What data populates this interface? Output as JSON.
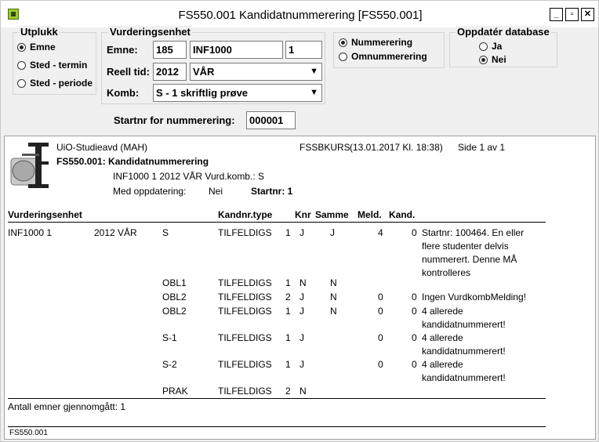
{
  "window": {
    "title": "FS550.001 Kandidatnummerering [FS550.001]"
  },
  "utplukk": {
    "title": "Utplukk",
    "options": [
      "Emne",
      "Sted - termin",
      "Sted - periode"
    ],
    "selected": 0
  },
  "vurderingsenhet": {
    "title": "Vurderingsenhet",
    "emne_label": "Emne:",
    "emne_institusjon": "185",
    "emne_kode": "INF1000",
    "emne_versjon": "1",
    "reell_tid_label": "Reell tid:",
    "aar": "2012",
    "termin": "VÅR",
    "komb_label": "Komb:",
    "komb": "S -  1 skriftlig prøve"
  },
  "mode": {
    "options": [
      "Nummerering",
      "Omnummerering"
    ],
    "selected": 0
  },
  "oppdater": {
    "title": "Oppdatér database",
    "options": [
      "Ja",
      "Nei"
    ],
    "selected": 1
  },
  "startnr": {
    "label": "Startnr for nummerering:",
    "value": "000001"
  },
  "report": {
    "org": "UiO-Studieavd (MAH)",
    "report_id": "FSSBKURS",
    "timestamp": "(13.01.2017 Kl. 18:38)",
    "page": "Side 1 av 1",
    "title": "FS550.001: Kandidatnummerering",
    "subtitle": "INF1000 1 2012 VÅR Vurd.komb.: S",
    "med_opp_label": "Med oppdatering:",
    "med_opp_value": "Nei",
    "startnr_label": "Startnr: 1",
    "headers": [
      "Vurderingsenhet",
      "Kandnr.type",
      "Knr",
      "Samme",
      "Meld.",
      "Kand."
    ],
    "rows": [
      {
        "ve": "INF1000 1",
        "tid": "2012 VÅR",
        "komb": "S",
        "type": "TILFELDIGS",
        "num": "1",
        "knr": "J",
        "samme": "J",
        "meld": "4",
        "kand": "0",
        "note": [
          "Startnr: 100464. En eller",
          "flere studenter delvis",
          "nummerert. Denne MÅ",
          "kontrolleres"
        ]
      },
      {
        "ve": "",
        "tid": "",
        "komb": "OBL1",
        "type": "TILFELDIGS",
        "num": "1",
        "knr": "N",
        "samme": "N",
        "meld": "",
        "kand": "",
        "note": []
      },
      {
        "ve": "",
        "tid": "",
        "komb": "OBL2",
        "type": "TILFELDIGS",
        "num": "2",
        "knr": "J",
        "samme": "N",
        "meld": "0",
        "kand": "0",
        "note": [
          "Ingen VurdkombMelding!"
        ]
      },
      {
        "ve": "",
        "tid": "",
        "komb": "OBL2",
        "type": "TILFELDIGS",
        "num": "1",
        "knr": "J",
        "samme": "N",
        "meld": "0",
        "kand": "0",
        "note": [
          "4 allerede",
          "kandidatnummerert!"
        ]
      },
      {
        "ve": "",
        "tid": "",
        "komb": "S-1",
        "type": "TILFELDIGS",
        "num": "1",
        "knr": "J",
        "samme": "",
        "meld": "0",
        "kand": "0",
        "note": [
          "4 allerede",
          "kandidatnummerert!"
        ]
      },
      {
        "ve": "",
        "tid": "",
        "komb": "S-2",
        "type": "TILFELDIGS",
        "num": "1",
        "knr": "J",
        "samme": "",
        "meld": "0",
        "kand": "0",
        "note": [
          "4 allerede",
          "kandidatnummerert!"
        ]
      },
      {
        "ve": "",
        "tid": "",
        "komb": "PRAK",
        "type": "TILFELDIGS",
        "num": "2",
        "knr": "N",
        "samme": "",
        "meld": "",
        "kand": "",
        "note": []
      }
    ],
    "footer_count": "Antall emner gjennomgått: 1",
    "footer_id": "FS550.001"
  },
  "colors": {
    "window_bg": "#f0f0f0",
    "report_bg": "#ffffff",
    "logo": "#2b2b2b"
  }
}
